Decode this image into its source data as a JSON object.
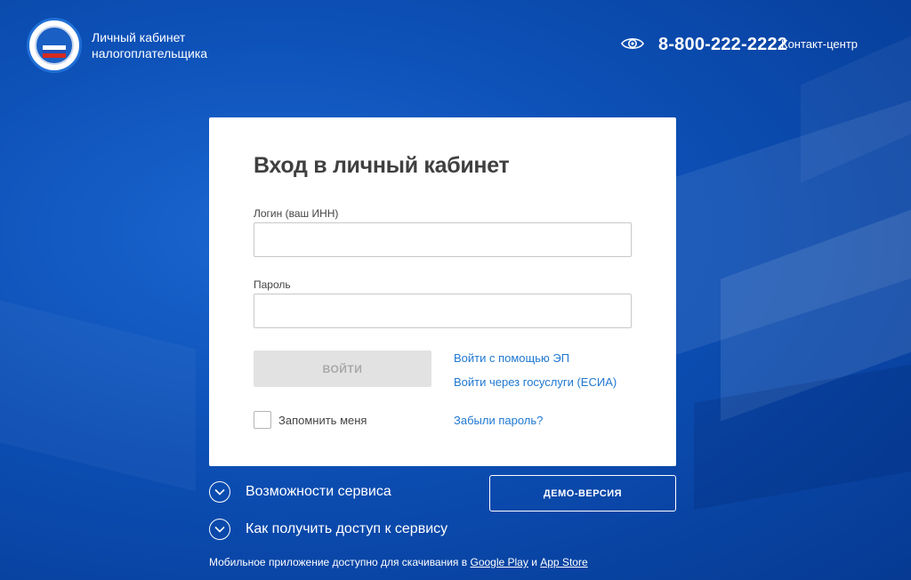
{
  "header": {
    "brand_line1": "Личный кабинет",
    "brand_line2": "налогоплательщика",
    "phone": "8-800-222-2222",
    "contact": "Контакт-центр"
  },
  "login": {
    "title": "Вход в личный кабинет",
    "login_label": "Логин (ваш ИНН)",
    "login_value": "",
    "password_label": "Пароль",
    "password_value": "",
    "submit": "ВОЙТИ",
    "link_ep": "Войти с помощью ЭП",
    "link_esia": "Войти через госуслуги (ЕСИА)",
    "remember": "Запомнить меня",
    "forgot": "Забыли пароль?"
  },
  "features": {
    "item1": "Возможности сервиса",
    "item2": "Как получить доступ к сервису",
    "demo": "ДЕМО-ВЕРСИЯ"
  },
  "footer": {
    "prefix": "Мобильное приложение доступно для скачивания в",
    "google_play": "Google Play",
    "and": "и",
    "app_store": "App Store"
  },
  "colors": {
    "background": "#0d4fb3",
    "link": "#1f78d1",
    "button_disabled": "#e2e2e2"
  },
  "icons": {
    "accessibility": "eye-icon",
    "expand": "chevron-down-icon"
  }
}
